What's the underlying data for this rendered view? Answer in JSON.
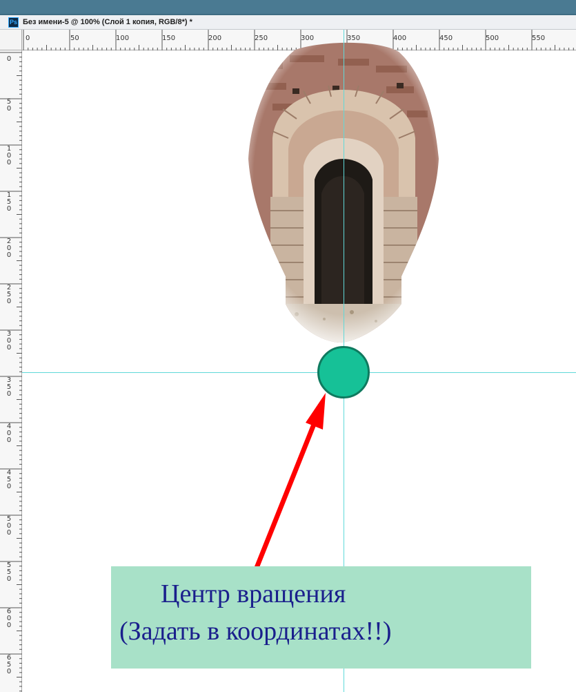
{
  "window": {
    "app_badge": "Ps",
    "document_title": "Без имени-5 @ 100% (Слой 1 копия, RGB/8*) *"
  },
  "rulers": {
    "horizontal_ticks": [
      "0",
      "50",
      "100",
      "150",
      "200",
      "250",
      "300",
      "350",
      "400",
      "450",
      "500",
      "550"
    ],
    "vertical_ticks": [
      "0",
      "50",
      "100",
      "150",
      "200",
      "250",
      "300",
      "350",
      "400",
      "450",
      "500",
      "550",
      "600",
      "650"
    ]
  },
  "canvas": {
    "image_subject": "stone-arch-window",
    "pivot_marker": "rotation-center-circle"
  },
  "annotation": {
    "line1": "Центр вращения",
    "line2": "(Задать в координатах!!)"
  },
  "colors": {
    "guide": "#5fd9d9",
    "pivot_fill": "#16c197",
    "pivot_border": "#0f7a5f",
    "arrow": "#ff0000",
    "callout_bg": "#a8e1c8",
    "callout_text": "#1a1f8c"
  }
}
